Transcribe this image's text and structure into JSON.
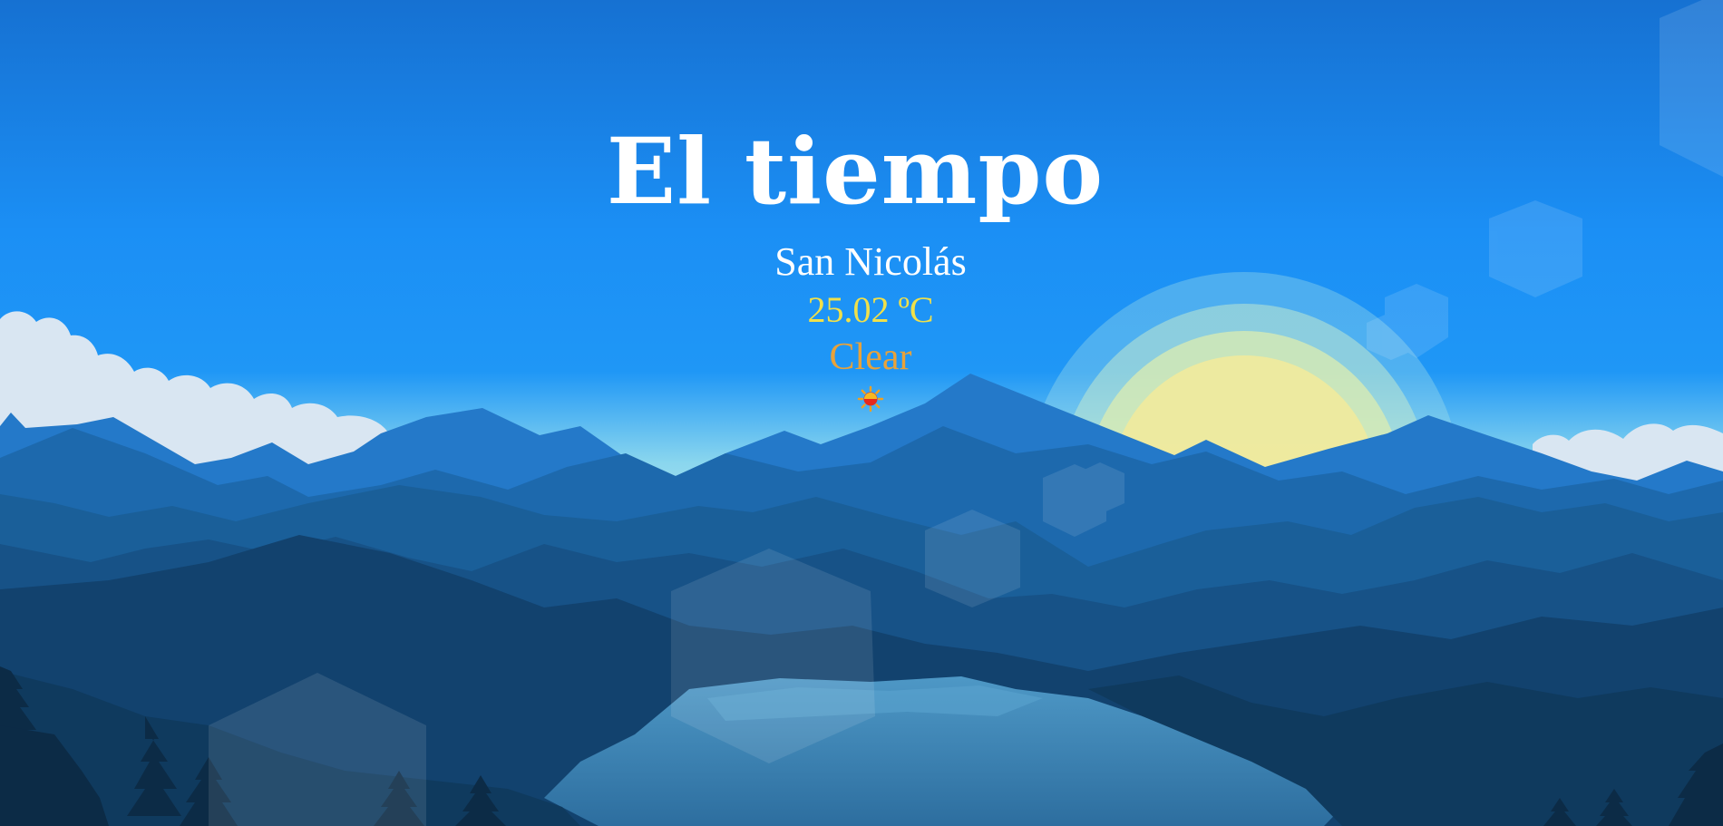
{
  "page": {
    "title": "El tiempo"
  },
  "weather": {
    "city": "San Nicolás",
    "temperature": "25.02 ºC",
    "condition": "Clear",
    "icon": "sun-icon"
  },
  "colors": {
    "sky_top": "#1671d2",
    "sky_mid": "#1a8ef5",
    "horizon": "#8ad6ee",
    "temperature_text": "#f0e04a",
    "condition_text": "#e8a23a",
    "sun_glow": "#f6ec9c",
    "mountain_dark": "#0e3556"
  }
}
